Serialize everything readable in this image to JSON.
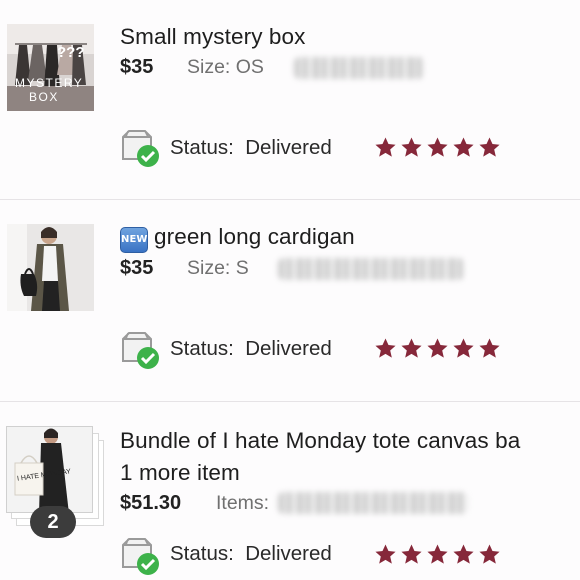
{
  "orders": [
    {
      "title": "Small mystery box",
      "price": "$35",
      "size_label": "Size: OS",
      "status_label": "Status:",
      "status_value": "Delivered",
      "rating": 5,
      "thumb_text_1": "???",
      "thumb_text_2": "MYSTERY",
      "thumb_text_3": "BOX"
    },
    {
      "title": "green long cardigan",
      "badge": "NEW",
      "price": "$35",
      "size_label": "Size: S",
      "status_label": "Status:",
      "status_value": "Delivered",
      "rating": 5
    },
    {
      "title": "Bundle of I hate Monday tote canvas ba",
      "title_line2": "1 more item",
      "price": "$51.30",
      "items_label": "Items:",
      "item_count": "2",
      "status_label": "Status:",
      "status_value": "Delivered",
      "rating": 5,
      "thumb_text": "I HATE MONDAY"
    }
  ],
  "colors": {
    "star": "#86283a",
    "check": "#3db24a",
    "badge": "#3a73c4"
  },
  "icons": {
    "status": "delivered-box-icon",
    "rating": "star-icon"
  }
}
